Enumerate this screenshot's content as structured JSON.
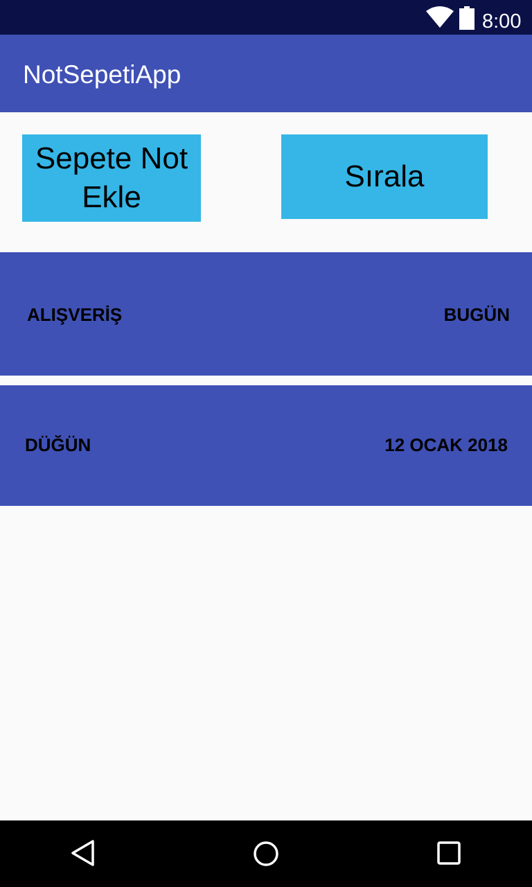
{
  "status_bar": {
    "time": "8:00",
    "icons": [
      "wifi-icon",
      "battery-icon"
    ]
  },
  "app_bar": {
    "title": "NotSepetiApp"
  },
  "actions": {
    "add_note_line1": "Sepete Not",
    "add_note_line2": "Ekle",
    "sort_label": "Sırala"
  },
  "notes": [
    {
      "title": "ALIŞVERİŞ",
      "date": "BUGÜN"
    },
    {
      "title": "DÜĞÜN",
      "date": "12 OCAK 2018"
    }
  ],
  "nav_bar": {
    "icons": [
      "back-icon",
      "home-icon",
      "recents-icon"
    ]
  },
  "colors": {
    "status_bar": "#0b1147",
    "app_bar": "#3f51b5",
    "button": "#35b6e6",
    "note_row": "#3f51b5",
    "background": "#fafafa"
  }
}
